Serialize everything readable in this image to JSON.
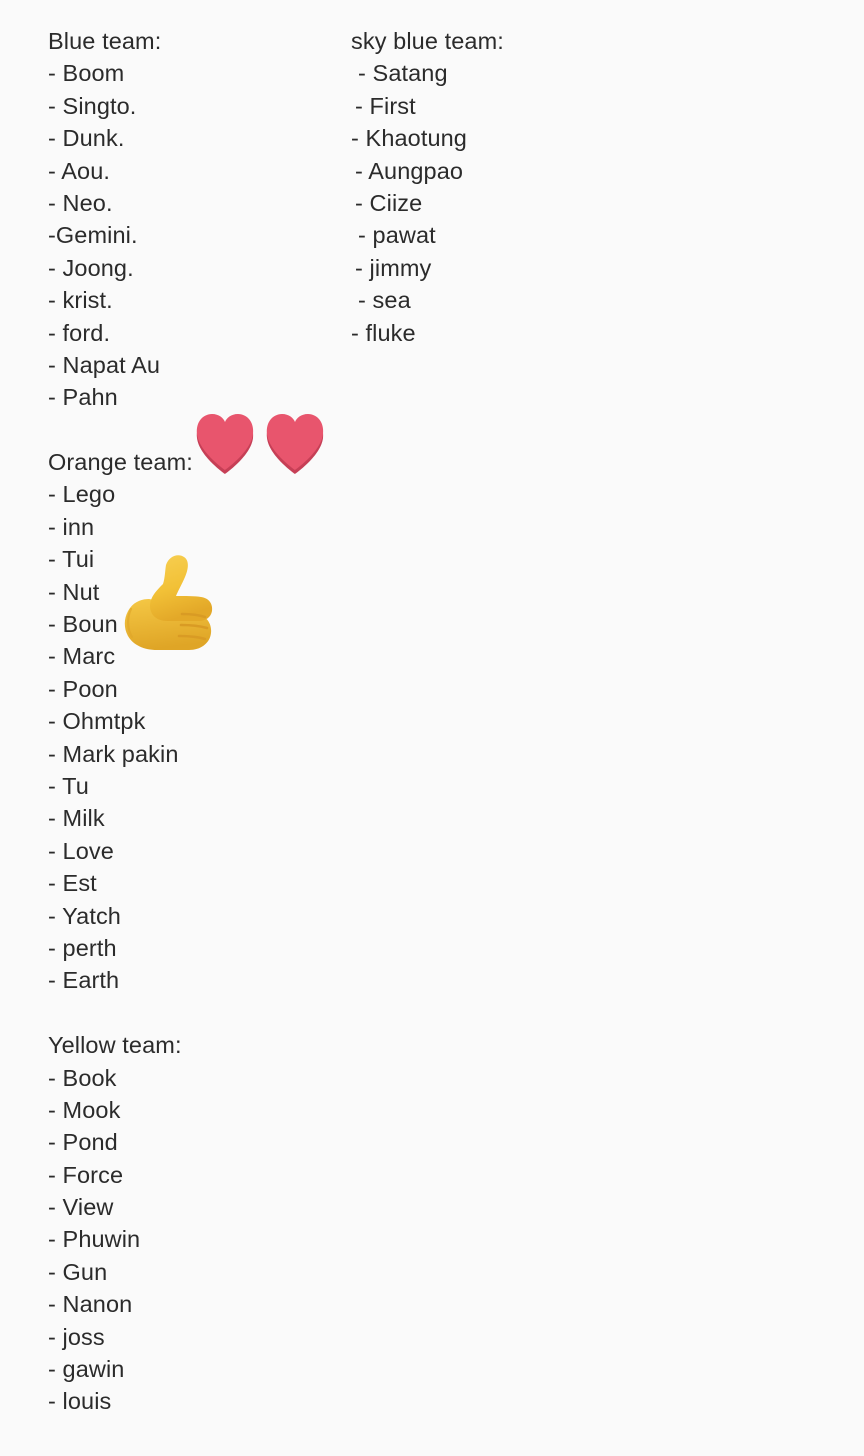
{
  "document": {
    "background_color": "#fafafa",
    "text_color": "#2b2b2b"
  },
  "teams": [
    {
      "id": "blue-team",
      "heading": "Blue team:",
      "members": [
        "- Boom",
        "- Singto.",
        "- Dunk.",
        "- Aou.",
        "- Neo.",
        "-Gemini.",
        "- Joong.",
        "- krist.",
        "- ford.",
        "- Napat Au",
        "- Pahn"
      ]
    },
    {
      "id": "sky-blue-team",
      "heading": "sky blue team:",
      "members": [
        "- Satang",
        "- First",
        "- Khaotung",
        "- Aungpao",
        "- Ciize",
        "- pawat",
        "- jimmy",
        "- sea",
        "- fluke"
      ]
    },
    {
      "id": "orange-team",
      "heading": "Orange team:",
      "members": [
        "- Lego",
        "- inn",
        "- Tui",
        "- Nut",
        "- Boun",
        "- Marc",
        "- Poon",
        "- Ohmtpk",
        "- Mark pakin",
        "- Tu",
        "- Milk",
        "- Love",
        "- Est",
        "- Yatch",
        "- perth",
        "- Earth"
      ]
    },
    {
      "id": "yellow-team",
      "heading": "Yellow team:",
      "members": [
        "- Book",
        "- Mook",
        "- Pond",
        "- Force",
        "- View",
        "- Phuwin",
        "- Gun",
        "- Nanon",
        "- joss",
        "- gawin",
        "- louis"
      ]
    }
  ],
  "emojis": [
    {
      "id": "two-hearts",
      "name": "heart-emoji",
      "glyph": "❤",
      "count": 2,
      "color": "#e8556d",
      "shadow_color": "#c63f56"
    },
    {
      "id": "thumbs-up",
      "name": "thumbs-up-emoji",
      "glyph": "👍",
      "count": 1,
      "color": "#f5c63c",
      "shadow_color": "#e0a92b"
    }
  ]
}
